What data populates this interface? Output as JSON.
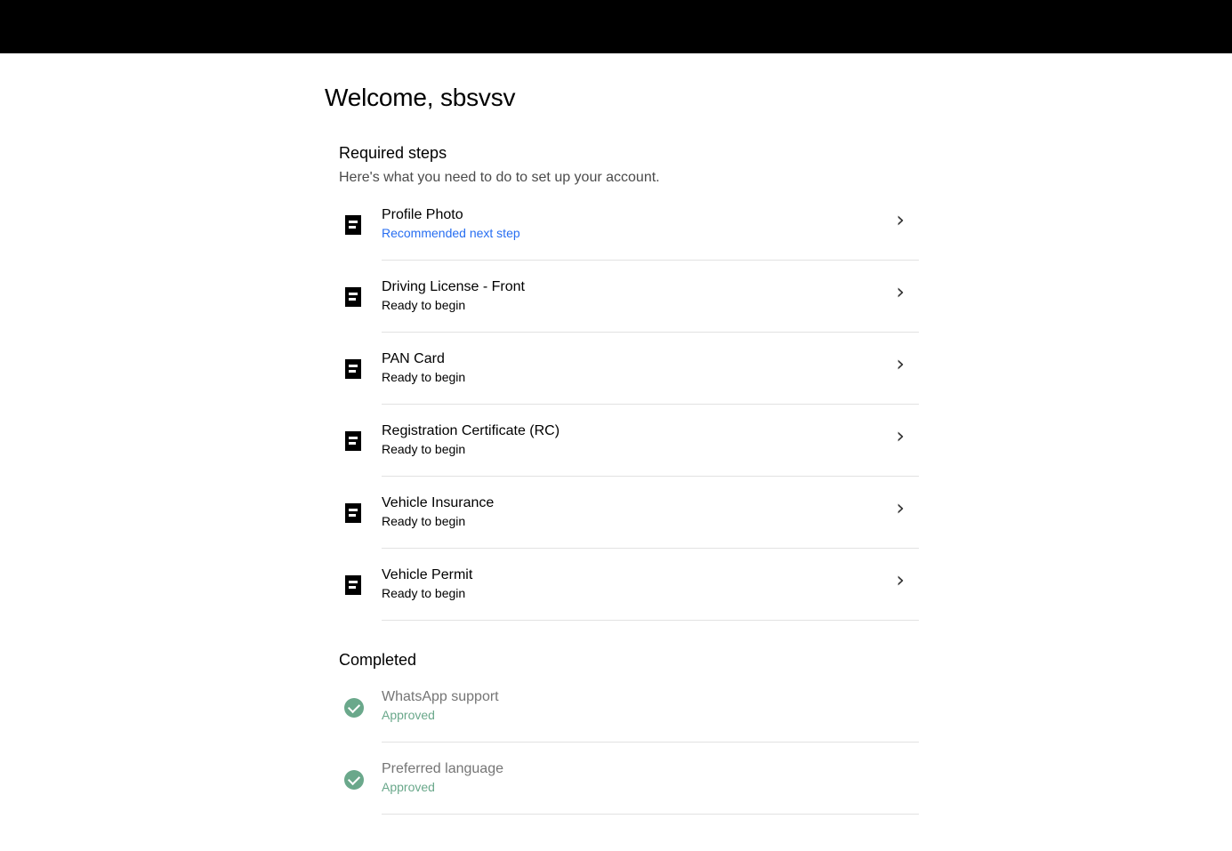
{
  "header": {
    "welcome": "Welcome, sbsvsv"
  },
  "required": {
    "title": "Required steps",
    "description": "Here's what you need to do to set up your account.",
    "steps": [
      {
        "label": "Profile Photo",
        "status": "Recommended next step",
        "icon": "document-icon"
      },
      {
        "label": "Driving License - Front",
        "status": "Ready to begin",
        "icon": "document-icon"
      },
      {
        "label": "PAN Card",
        "status": "Ready to begin",
        "icon": "document-icon"
      },
      {
        "label": "Registration Certificate (RC)",
        "status": "Ready to begin",
        "icon": "document-icon"
      },
      {
        "label": "Vehicle Insurance",
        "status": "Ready to begin",
        "icon": "document-icon"
      },
      {
        "label": "Vehicle Permit",
        "status": "Ready to begin",
        "icon": "document-icon"
      }
    ]
  },
  "completed": {
    "title": "Completed",
    "steps": [
      {
        "label": "WhatsApp support",
        "status": "Approved",
        "icon": "check-circle-icon"
      },
      {
        "label": "Preferred language",
        "status": "Approved",
        "icon": "check-circle-icon"
      }
    ]
  },
  "colors": {
    "accent_blue": "#276ef1",
    "approved_green": "#6aa88b",
    "top_bar": "#000000"
  }
}
